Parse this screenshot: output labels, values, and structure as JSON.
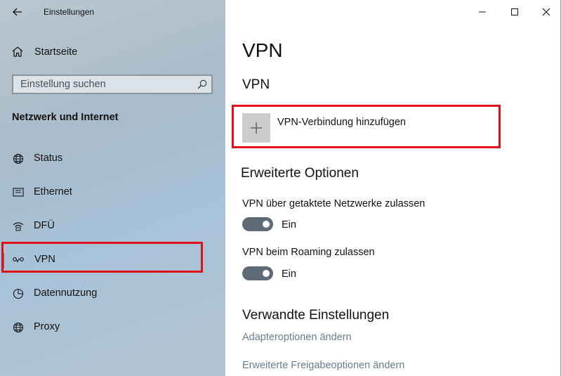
{
  "window": {
    "title": "Einstellungen",
    "back_icon": "back-arrow-icon",
    "minimize_icon": "minimize-icon",
    "maximize_icon": "maximize-icon",
    "close_icon": "close-icon"
  },
  "sidebar": {
    "home": {
      "label": "Startseite",
      "icon": "home-icon"
    },
    "search": {
      "placeholder": "Einstellung suchen",
      "value": "",
      "icon": "search-icon"
    },
    "section_heading": "Netzwerk und Internet",
    "items": [
      {
        "label": "Status",
        "icon": "globe-icon",
        "selected": false
      },
      {
        "label": "Ethernet",
        "icon": "ethernet-icon",
        "selected": false
      },
      {
        "label": "DFÜ",
        "icon": "dialup-icon",
        "selected": false
      },
      {
        "label": "VPN",
        "icon": "vpn-icon",
        "selected": true
      },
      {
        "label": "Datennutzung",
        "icon": "data-usage-icon",
        "selected": false
      },
      {
        "label": "Proxy",
        "icon": "globe-icon",
        "selected": false
      }
    ]
  },
  "main": {
    "page_title": "VPN",
    "section_title": "VPN",
    "add_vpn": {
      "label": "VPN-Verbindung hinzufügen",
      "icon": "plus-icon"
    },
    "advanced": {
      "heading": "Erweiterte Optionen",
      "options": [
        {
          "label": "VPN über getaktete Netzwerke zulassen",
          "state": "Ein",
          "on": true
        },
        {
          "label": "VPN beim Roaming zulassen",
          "state": "Ein",
          "on": true
        }
      ]
    },
    "related": {
      "heading": "Verwandte Einstellungen",
      "links": [
        "Adapteroptionen ändern",
        "Erweiterte Freigabeoptionen ändern"
      ]
    }
  },
  "colors": {
    "highlight": "#e0101a",
    "toggle_on": "#5e6a78",
    "link": "#6b7d8d"
  }
}
